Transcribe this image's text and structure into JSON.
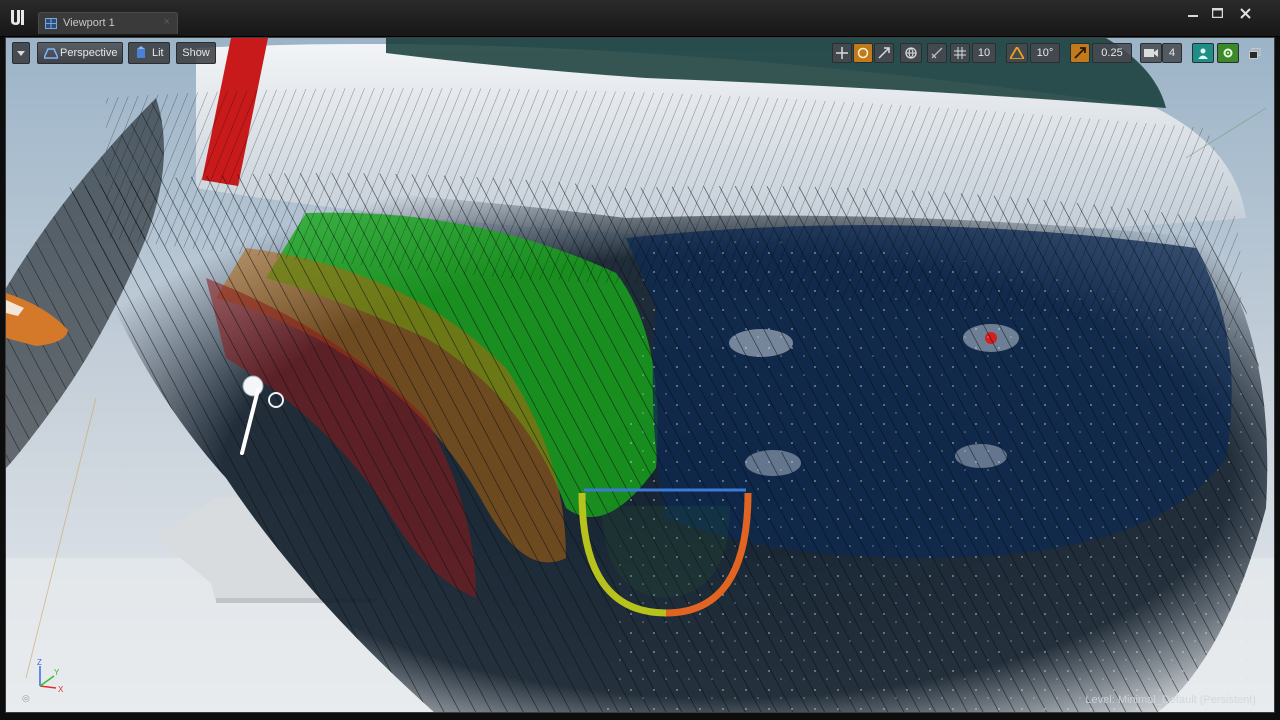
{
  "window": {
    "tab_title": "Viewport 1",
    "tab_close": "×"
  },
  "toolbar": {
    "dropdown_icon": "chevron-down-icon",
    "perspective_label": "Perspective",
    "lit_label": "Lit",
    "show_label": "Show",
    "grid_snap_value": "10",
    "rotation_snap_value": "10°",
    "scale_snap_value": "0.25",
    "camera_speed_value": "4"
  },
  "status": {
    "level_text": "Level:  Minimal_Default (Persistent)"
  },
  "axis": {
    "x": "X",
    "y": "Y",
    "z": "Z"
  },
  "colors": {
    "accent_orange": "#c07a1c",
    "accent_green": "#3a8a2a",
    "accent_teal": "#1f8e86",
    "sky": "#9fb6c9"
  }
}
